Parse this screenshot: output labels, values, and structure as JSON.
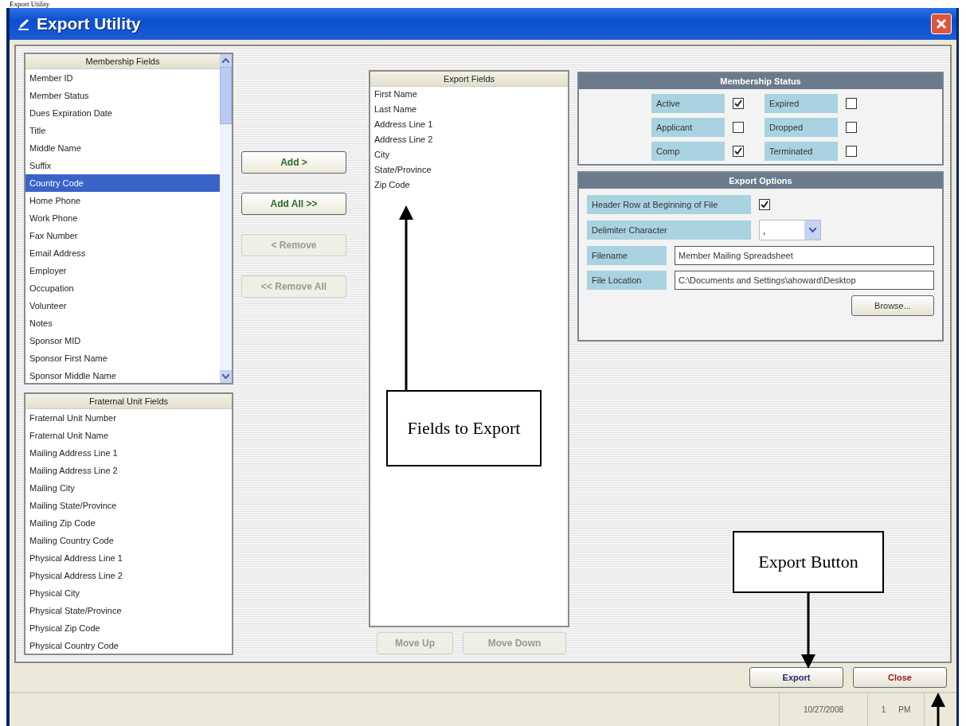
{
  "document_caption": "Export Utility",
  "window": {
    "title": "Export Utility"
  },
  "membership_fields": {
    "header": "Membership Fields",
    "items": [
      {
        "label": "Member ID",
        "selected": false
      },
      {
        "label": "Member Status",
        "selected": false
      },
      {
        "label": "Dues Expiration Date",
        "selected": false
      },
      {
        "label": "Title",
        "selected": false
      },
      {
        "label": "Middle Name",
        "selected": false
      },
      {
        "label": "Suffix",
        "selected": false
      },
      {
        "label": "Country Code",
        "selected": true
      },
      {
        "label": "Home Phone",
        "selected": false
      },
      {
        "label": "Work Phone",
        "selected": false
      },
      {
        "label": "Fax Number",
        "selected": false
      },
      {
        "label": "Email Address",
        "selected": false
      },
      {
        "label": "Employer",
        "selected": false
      },
      {
        "label": "Occupation",
        "selected": false
      },
      {
        "label": "Volunteer",
        "selected": false
      },
      {
        "label": "Notes",
        "selected": false
      },
      {
        "label": "Sponsor MID",
        "selected": false
      },
      {
        "label": "Sponsor First Name",
        "selected": false
      },
      {
        "label": "Sponsor Middle Name",
        "selected": false
      }
    ]
  },
  "fraternal_unit_fields": {
    "header": "Fraternal Unit Fields",
    "items": [
      {
        "label": "Fraternal Unit Number",
        "selected": false
      },
      {
        "label": "Fraternal Unit Name",
        "selected": false
      },
      {
        "label": "Mailing Address Line 1",
        "selected": false
      },
      {
        "label": "Mailing Address Line 2",
        "selected": false
      },
      {
        "label": "Mailing City",
        "selected": false
      },
      {
        "label": "Mailing State/Province",
        "selected": false
      },
      {
        "label": "Mailing Zip Code",
        "selected": false
      },
      {
        "label": "Mailing Country Code",
        "selected": false
      },
      {
        "label": "Physical Address Line 1",
        "selected": false
      },
      {
        "label": "Physical Address Line 2",
        "selected": false
      },
      {
        "label": "Physical City",
        "selected": false
      },
      {
        "label": "Physical State/Province",
        "selected": false
      },
      {
        "label": "Physical Zip Code",
        "selected": false
      },
      {
        "label": "Physical Country Code",
        "selected": false
      }
    ]
  },
  "transfer_buttons": [
    {
      "label": "Add >",
      "disabled": false
    },
    {
      "label": "Add All >>",
      "disabled": false
    },
    {
      "label": "< Remove",
      "disabled": true
    },
    {
      "label": "<< Remove All",
      "disabled": true
    }
  ],
  "export_fields": {
    "header": "Export Fields",
    "items": [
      {
        "label": "First Name",
        "selected": false
      },
      {
        "label": "Last Name",
        "selected": false
      },
      {
        "label": "Address Line 1",
        "selected": false
      },
      {
        "label": "Address Line 2",
        "selected": false
      },
      {
        "label": "City",
        "selected": false
      },
      {
        "label": "State/Province",
        "selected": false
      },
      {
        "label": "Zip Code",
        "selected": false
      }
    ]
  },
  "move_buttons": [
    {
      "label": "Move Up",
      "disabled": true
    },
    {
      "label": "Move Down",
      "disabled": true
    }
  ],
  "membership_status": {
    "title": "Membership Status",
    "options": [
      {
        "label": "Active",
        "checked": true
      },
      {
        "label": "Expired",
        "checked": false
      },
      {
        "label": "Applicant",
        "checked": false
      },
      {
        "label": "Dropped",
        "checked": false
      },
      {
        "label": "Comp",
        "checked": true
      },
      {
        "label": "Terminated",
        "checked": false
      }
    ]
  },
  "export_options": {
    "title": "Export Options",
    "header_row": {
      "label": "Header Row at Beginning of File",
      "checked": true
    },
    "delimiter": {
      "label": "Delimiter Character",
      "value": ","
    },
    "filename": {
      "label": "Filename",
      "value": "Member Mailing Spreadsheet"
    },
    "file_location": {
      "label": "File Location",
      "value": "C:\\Documents and Settings\\ahoward\\Desktop"
    },
    "browse_button": "Browse..."
  },
  "footer_buttons": [
    {
      "label": "Export",
      "kind": "export"
    },
    {
      "label": "Close",
      "kind": "close"
    }
  ],
  "status_bar": {
    "date": "10/27/2008",
    "time_parts": [
      "1",
      "PM"
    ]
  },
  "callouts": [
    {
      "text": "Fields to Export",
      "kind": "fields"
    },
    {
      "text": "Export Button",
      "kind": "export"
    }
  ]
}
